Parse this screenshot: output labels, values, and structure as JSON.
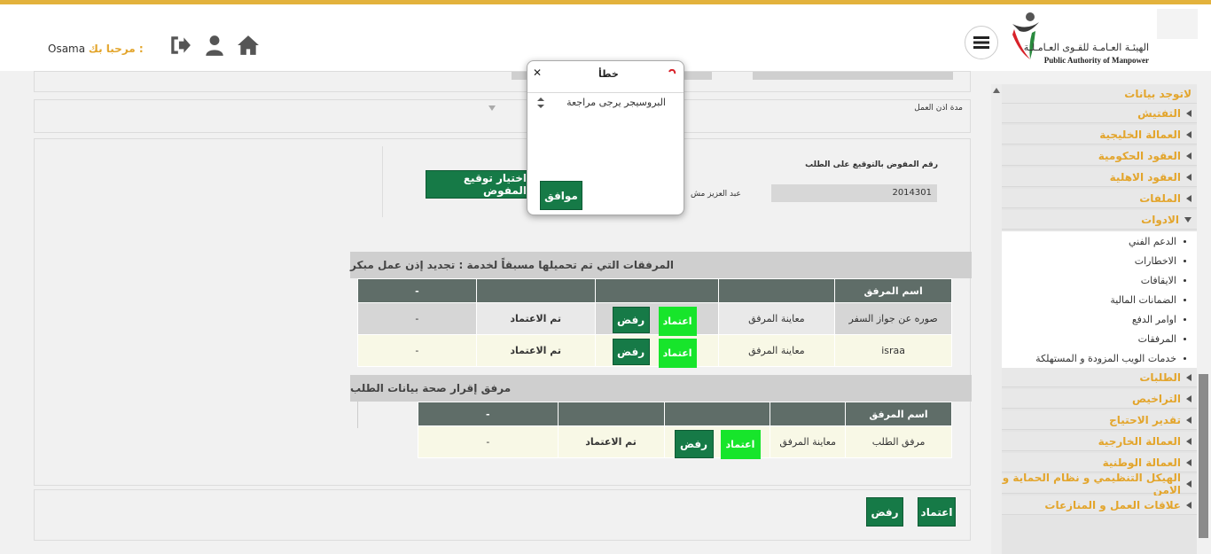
{
  "header": {
    "org_name_ar": "الهيئـة العـامـة للقـوى العـامـلـة",
    "org_name_en": "Public Authority of Manpower",
    "welcome_label": "مرحبا بك :",
    "username": "Osama"
  },
  "form": {
    "work_permit_duration_label": "مدة اذن العمل",
    "delegate_number_label": "رقم المفوض بالتوقيع على الطلب",
    "delegate_number_value": "2014301",
    "delegate_name_value": "عبد العزيز مش",
    "choose_signature_button": "اختيار توقيع المفوض"
  },
  "attachments_section": {
    "title": "المرفقات التي تم تحميلها مسبقاً لخدمة : تجديد إذن عمل مبكر",
    "columns": [
      "اسم المرفق",
      "",
      "",
      "",
      "-"
    ],
    "rows": [
      {
        "name": "صوره عن جواز السفر",
        "view": "معاينة المرفق",
        "approve": "اعتماد",
        "reject": "رفض",
        "status": "تم الاعتماد",
        "extra": "-"
      },
      {
        "name": "israa",
        "view": "معاينة المرفق",
        "approve": "اعتماد",
        "reject": "رفض",
        "status": "تم الاعتماد",
        "extra": "-"
      }
    ]
  },
  "declaration_section": {
    "title": "مرفق إقرار صحة بيانات الطلب",
    "columns": [
      "اسم المرفق",
      "",
      "",
      "",
      "-"
    ],
    "rows": [
      {
        "name": "مرفق الطلب",
        "view": "معاينة المرفق",
        "approve": "اعتماد",
        "reject": "رفض",
        "status": "تم الاعتماد",
        "extra": "-"
      }
    ]
  },
  "footer_actions": {
    "approve": "اعتماد",
    "reject": "رفض"
  },
  "sidebar": {
    "items": [
      {
        "label": "لاتوجد بيانات"
      },
      {
        "label": "التفتيش"
      },
      {
        "label": "العمالة الخليجية"
      },
      {
        "label": "العقود الحكومية"
      },
      {
        "label": "العقود الاهلية"
      },
      {
        "label": "الملفات"
      },
      {
        "label": "الادوات"
      },
      {
        "label": "الطلبات"
      },
      {
        "label": "التراخيص"
      },
      {
        "label": "تقدير الاحتياج"
      },
      {
        "label": "العمالة الخارجية"
      },
      {
        "label": "العمالة الوطنية"
      },
      {
        "label": "الهيكل التنظيمي و نظام الحماية و الامن"
      },
      {
        "label": "علاقات العمل و المنازعات"
      }
    ],
    "tools_subitems": [
      "الدعم الفني",
      "الاخطارات",
      "الايقافات",
      "الضمانات المالية",
      "اوامر الدفع",
      "المرفقات",
      "خدمات الويب المزودة و المستهلكة"
    ]
  },
  "dialog": {
    "title": "خطأ",
    "message": "البروسيجر يرجى مراجعة",
    "ok_button": "موافق"
  },
  "colors": {
    "accent": "#e3b23c",
    "primary_green": "#167a47",
    "lime": "#17e52b",
    "table_header": "#5f6d68"
  }
}
